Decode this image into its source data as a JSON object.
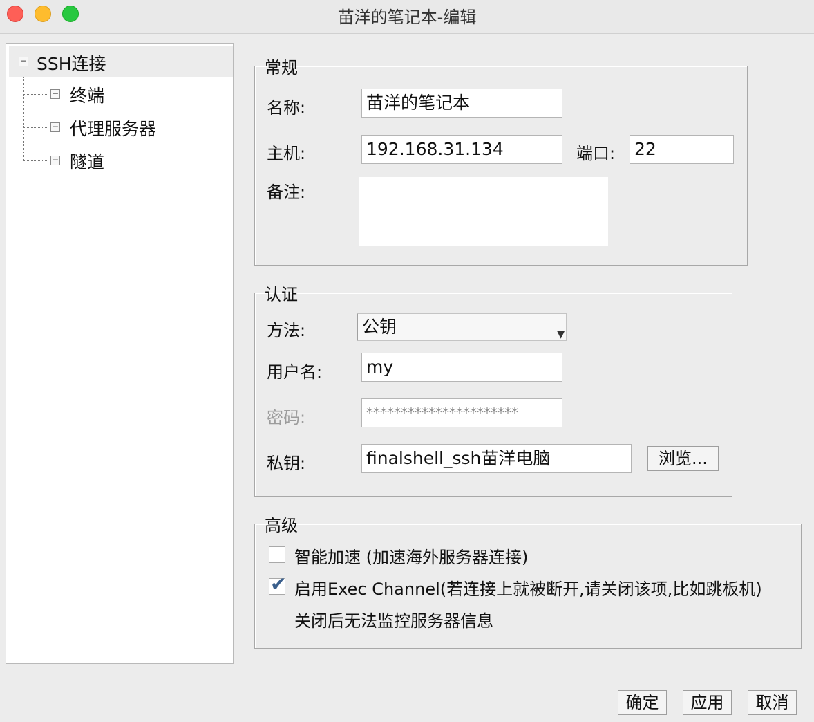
{
  "window": {
    "title": "苗洋的笔记本-编辑"
  },
  "tree": {
    "root": {
      "toggle": "−",
      "label": "SSH连接"
    },
    "children": [
      {
        "toggle": "−",
        "label": "终端"
      },
      {
        "toggle": "−",
        "label": "代理服务器"
      },
      {
        "toggle": "−",
        "label": "隧道"
      }
    ]
  },
  "general": {
    "legend": "常规",
    "name_label": "名称:",
    "name_value": "苗洋的笔记本",
    "host_label": "主机:",
    "host_value": "192.168.31.134",
    "port_label": "端口:",
    "port_value": "22",
    "notes_label": "备注:",
    "notes_value": ""
  },
  "auth": {
    "legend": "认证",
    "method_label": "方法:",
    "method_value": "公钥",
    "username_label": "用户名:",
    "username_value": "my",
    "password_label": "密码:",
    "password_value": "**********************",
    "key_label": "私钥:",
    "key_value": "finalshell_ssh苗洋电脑",
    "browse_label": "浏览..."
  },
  "advanced": {
    "legend": "高级",
    "accelerate_label": "智能加速 (加速海外服务器连接)",
    "accelerate_checked": false,
    "exec_label": "启用Exec Channel(若连接上就被断开,请关闭该项,比如跳板机)",
    "exec_checked": true,
    "exec_note": "关闭后无法监控服务器信息"
  },
  "footer": {
    "ok_label": "确定",
    "apply_label": "应用",
    "cancel_label": "取消"
  }
}
